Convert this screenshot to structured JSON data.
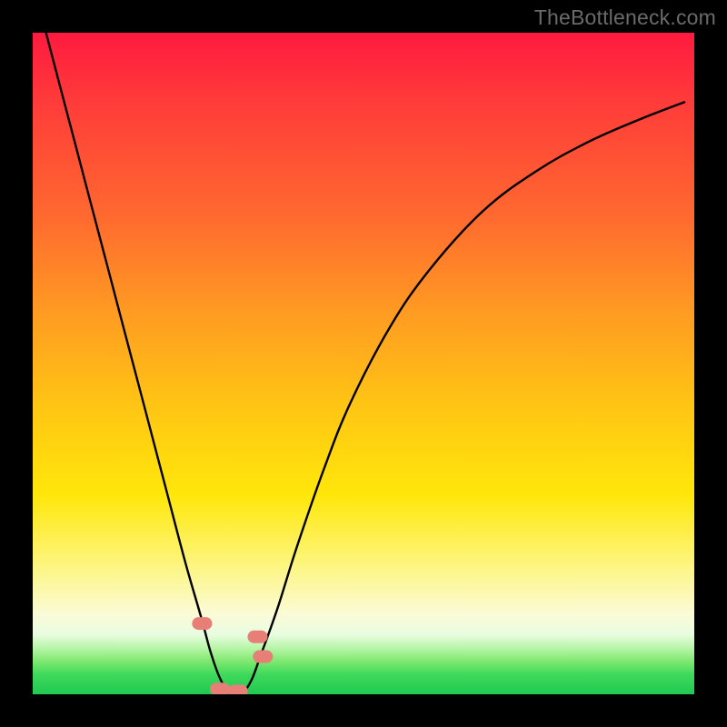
{
  "watermark": "TheBottleneck.com",
  "chart_data": {
    "type": "line",
    "title": "",
    "xlabel": "",
    "ylabel": "",
    "xlim": [
      0,
      1
    ],
    "ylim": [
      0,
      1
    ],
    "annotations": [],
    "gradient_stops": [
      {
        "pos": 0.0,
        "color": "#ff1a3f"
      },
      {
        "pos": 0.1,
        "color": "#ff3a3a"
      },
      {
        "pos": 0.28,
        "color": "#ff6a2f"
      },
      {
        "pos": 0.42,
        "color": "#ff9a22"
      },
      {
        "pos": 0.56,
        "color": "#ffc414"
      },
      {
        "pos": 0.7,
        "color": "#ffe70a"
      },
      {
        "pos": 0.8,
        "color": "#fdf57a"
      },
      {
        "pos": 0.88,
        "color": "#fbfbd8"
      },
      {
        "pos": 0.91,
        "color": "#e8fce0"
      },
      {
        "pos": 0.93,
        "color": "#b8f6a8"
      },
      {
        "pos": 0.95,
        "color": "#7fe870"
      },
      {
        "pos": 0.97,
        "color": "#3fd95c"
      },
      {
        "pos": 1.0,
        "color": "#1fc94f"
      }
    ],
    "series": [
      {
        "name": "curve",
        "color": "#000000",
        "x": [
          0.02,
          0.05,
          0.08,
          0.11,
          0.14,
          0.17,
          0.2,
          0.23,
          0.255,
          0.27,
          0.285,
          0.3,
          0.315,
          0.33,
          0.345,
          0.37,
          0.4,
          0.44,
          0.48,
          0.54,
          0.6,
          0.68,
          0.76,
          0.84,
          0.92,
          0.985
        ],
        "y": [
          1.0,
          0.886,
          0.772,
          0.658,
          0.544,
          0.43,
          0.316,
          0.202,
          0.115,
          0.06,
          0.02,
          0.0,
          0.0,
          0.02,
          0.06,
          0.13,
          0.225,
          0.34,
          0.44,
          0.555,
          0.642,
          0.73,
          0.79,
          0.835,
          0.87,
          0.895
        ]
      }
    ],
    "markers": [
      {
        "name": "marker-left",
        "x": 0.256,
        "y": 0.107,
        "color": "#e77f76"
      },
      {
        "name": "marker-right-upper",
        "x": 0.34,
        "y": 0.087,
        "color": "#e77f76"
      },
      {
        "name": "marker-right-lower",
        "x": 0.348,
        "y": 0.057,
        "color": "#e77f76"
      },
      {
        "name": "marker-bottom-1",
        "x": 0.283,
        "y": 0.008,
        "color": "#e77f76"
      },
      {
        "name": "marker-bottom-2",
        "x": 0.31,
        "y": 0.005,
        "color": "#e77f76"
      }
    ]
  }
}
